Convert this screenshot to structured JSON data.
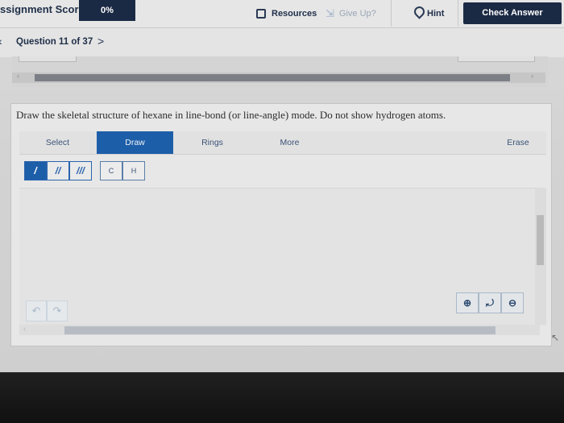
{
  "header": {
    "score_label": "ssignment Score:",
    "score_value": "0%",
    "resources_label": "Resources",
    "give_up_label": "Give Up?",
    "hint_label": "Hint",
    "check_answer_label": "Check Answer"
  },
  "nav": {
    "prev_symbol": "‹",
    "question_label": "Question 11 of 37",
    "next_symbol": ">"
  },
  "question": {
    "prompt": "Draw the skeletal structure of hexane in line-bond (or line-angle) mode. Do not show hydrogen atoms."
  },
  "toolbar": {
    "select_label": "Select",
    "draw_label": "Draw",
    "rings_label": "Rings",
    "more_label": "More",
    "erase_label": "Erase",
    "active_tab": "Draw"
  },
  "bond_tools": {
    "single": "/",
    "double": "//",
    "triple": "///",
    "active": "single"
  },
  "atom_tools": {
    "carbon": "C",
    "hydrogen": "H"
  },
  "colors": {
    "header_navy": "#1b2a44",
    "active_blue": "#1d5ea9",
    "label_blue": "#3b5478"
  },
  "icons": {
    "resources": "document-icon",
    "give_up": "give-up-icon",
    "hint": "lightbulb-icon",
    "undo": "undo-icon",
    "redo": "redo-icon",
    "zoom_in": "zoom-in-icon",
    "zoom_reset": "zoom-reset-icon",
    "zoom_out": "zoom-out-icon"
  }
}
